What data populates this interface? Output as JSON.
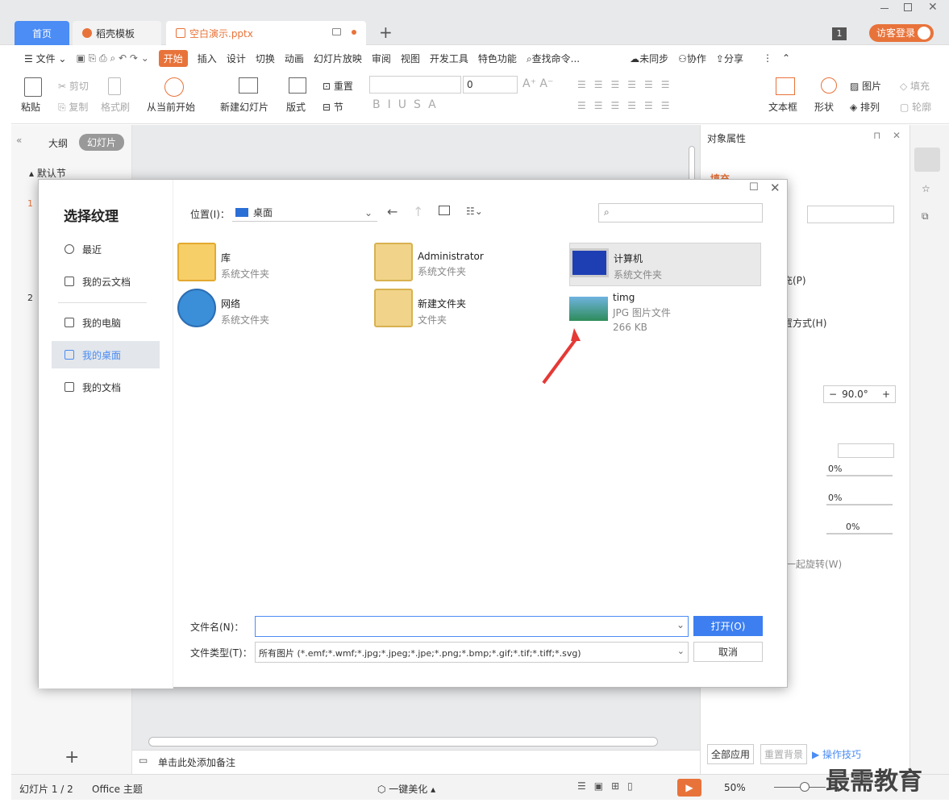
{
  "tabs": {
    "home": "首页",
    "template": "稻壳模板",
    "document": "空白演示.pptx",
    "page_badge": "1",
    "login": "访客登录"
  },
  "menu": {
    "file": "文件",
    "start": "开始",
    "items": [
      "插入",
      "设计",
      "切换",
      "动画",
      "幻灯片放映",
      "审阅",
      "视图",
      "开发工具",
      "特色功能"
    ],
    "search": "查找命令...",
    "unsynced": "未同步",
    "collab": "协作",
    "share": "分享"
  },
  "ribbon": {
    "paste": "粘贴",
    "cut": "剪切",
    "copy": "复制",
    "format_painter": "格式刷",
    "from_current": "从当前开始",
    "new_slide": "新建幻灯片",
    "layout": "版式",
    "reset": "重置",
    "section": "节",
    "font_size": "0",
    "textbox": "文本框",
    "shape": "形状",
    "picture": "图片",
    "arrange": "排列",
    "fill": "填充",
    "outline": "轮廓"
  },
  "left_panel": {
    "outline_tab": "大纲",
    "slides_tab": "幻灯片",
    "section": "默认节",
    "slide_nums": [
      "1",
      "2"
    ]
  },
  "right_panel": {
    "title": "对象属性",
    "fill_tab": "填充",
    "fill_opt": "填充(P)",
    "tile_opt": "放置方式(H)",
    "angle": "90.0°",
    "pct1": "0%",
    "pct2": "0%",
    "pct3": "0%",
    "rotate": "与形状一起旋转(W)",
    "apply_all": "全部应用",
    "reset_bg": "重置背景",
    "tips": "操作技巧"
  },
  "notes": {
    "placeholder": "单击此处添加备注"
  },
  "status": {
    "slide_counter": "幻灯片 1 / 2",
    "theme": "Office 主题",
    "beautify": "一键美化",
    "zoom": "50%"
  },
  "dialog": {
    "title": "选择纹理",
    "location_label": "位置(I)：",
    "location_value": "桌面",
    "search_placeholder": "",
    "sidebar": [
      "最近",
      "我的云文档",
      "我的电脑",
      "我的桌面",
      "我的文档"
    ],
    "files": [
      {
        "name": "库",
        "type": "系统文件夹",
        "size": ""
      },
      {
        "name": "Administrator",
        "type": "系统文件夹",
        "size": ""
      },
      {
        "name": "计算机",
        "type": "系统文件夹",
        "size": ""
      },
      {
        "name": "网络",
        "type": "系统文件夹",
        "size": ""
      },
      {
        "name": "新建文件夹",
        "type": "文件夹",
        "size": ""
      },
      {
        "name": "timg",
        "type": "JPG 图片文件",
        "size": "266 KB"
      }
    ],
    "filename_label": "文件名(N)：",
    "filename_value": "",
    "filetype_label": "文件类型(T)：",
    "filetype_value": "所有图片 (*.emf;*.wmf;*.jpg;*.jpeg;*.jpe;*.png;*.bmp;*.gif;*.tif;*.tiff;*.svg)",
    "open_button": "打开(O)",
    "cancel_button": "取消"
  },
  "watermark": "最需教育",
  "colors": {
    "accent": "#4b8cf5",
    "orange": "#e8733a",
    "selected": "#e3e6ea",
    "arrow": "#e53935"
  }
}
